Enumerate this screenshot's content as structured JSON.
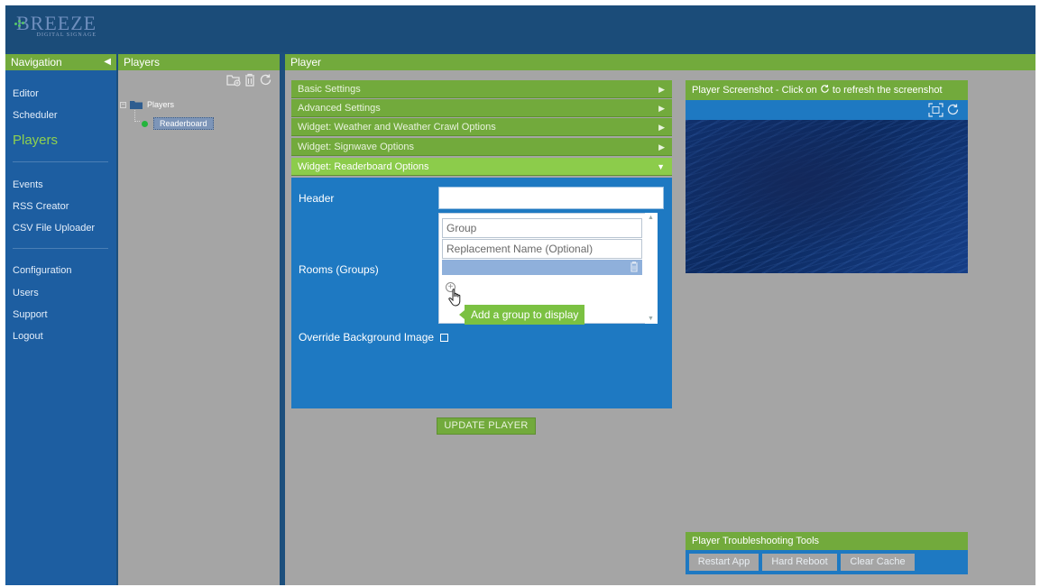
{
  "logo": {
    "brand": "BREEZE",
    "tagline": "DIGITAL SIGNAGE"
  },
  "navigation": {
    "title": "Navigation",
    "items": [
      {
        "label": "Editor"
      },
      {
        "label": "Scheduler"
      },
      {
        "label": "Players",
        "active": true
      },
      {
        "label": "Events"
      },
      {
        "label": "RSS Creator"
      },
      {
        "label": "CSV File Uploader"
      },
      {
        "label": "Configuration"
      },
      {
        "label": "Users"
      },
      {
        "label": "Support"
      },
      {
        "label": "Logout"
      }
    ]
  },
  "players_panel": {
    "title": "Players",
    "tree_root": "Players",
    "tree_child": "Readerboard"
  },
  "player_panel": {
    "title": "Player",
    "sections": [
      {
        "label": "Basic Settings"
      },
      {
        "label": "Advanced Settings"
      },
      {
        "label": "Widget: Weather and Weather Crawl Options"
      },
      {
        "label": "Widget: Signwave Options"
      },
      {
        "label": "Widget: Readerboard Options",
        "open": true
      }
    ],
    "form": {
      "header_label": "Header",
      "header_value": "",
      "rooms_label": "Rooms (Groups)",
      "group_placeholder": "Group",
      "replacement_placeholder": "Replacement Name (Optional)",
      "add_tooltip": "Add a group to display",
      "override_label": "Override Background Image",
      "override_checked": false
    },
    "update_button": "UPDATE PLAYER",
    "screenshot": {
      "title_prefix": "Player Screenshot - Click on",
      "title_suffix": "to refresh the screenshot"
    },
    "troubleshooting": {
      "title": "Player Troubleshooting Tools",
      "buttons": [
        "Restart App",
        "Hard Reboot",
        "Clear Cache"
      ]
    }
  },
  "colors": {
    "header_green": "#72aa3c",
    "active_green": "#8ccc4b",
    "nav_blue": "#1d5ea1",
    "form_blue": "#1e79c2",
    "panel_grey": "#a5a5a5",
    "topbar_blue": "#1b4c79"
  }
}
